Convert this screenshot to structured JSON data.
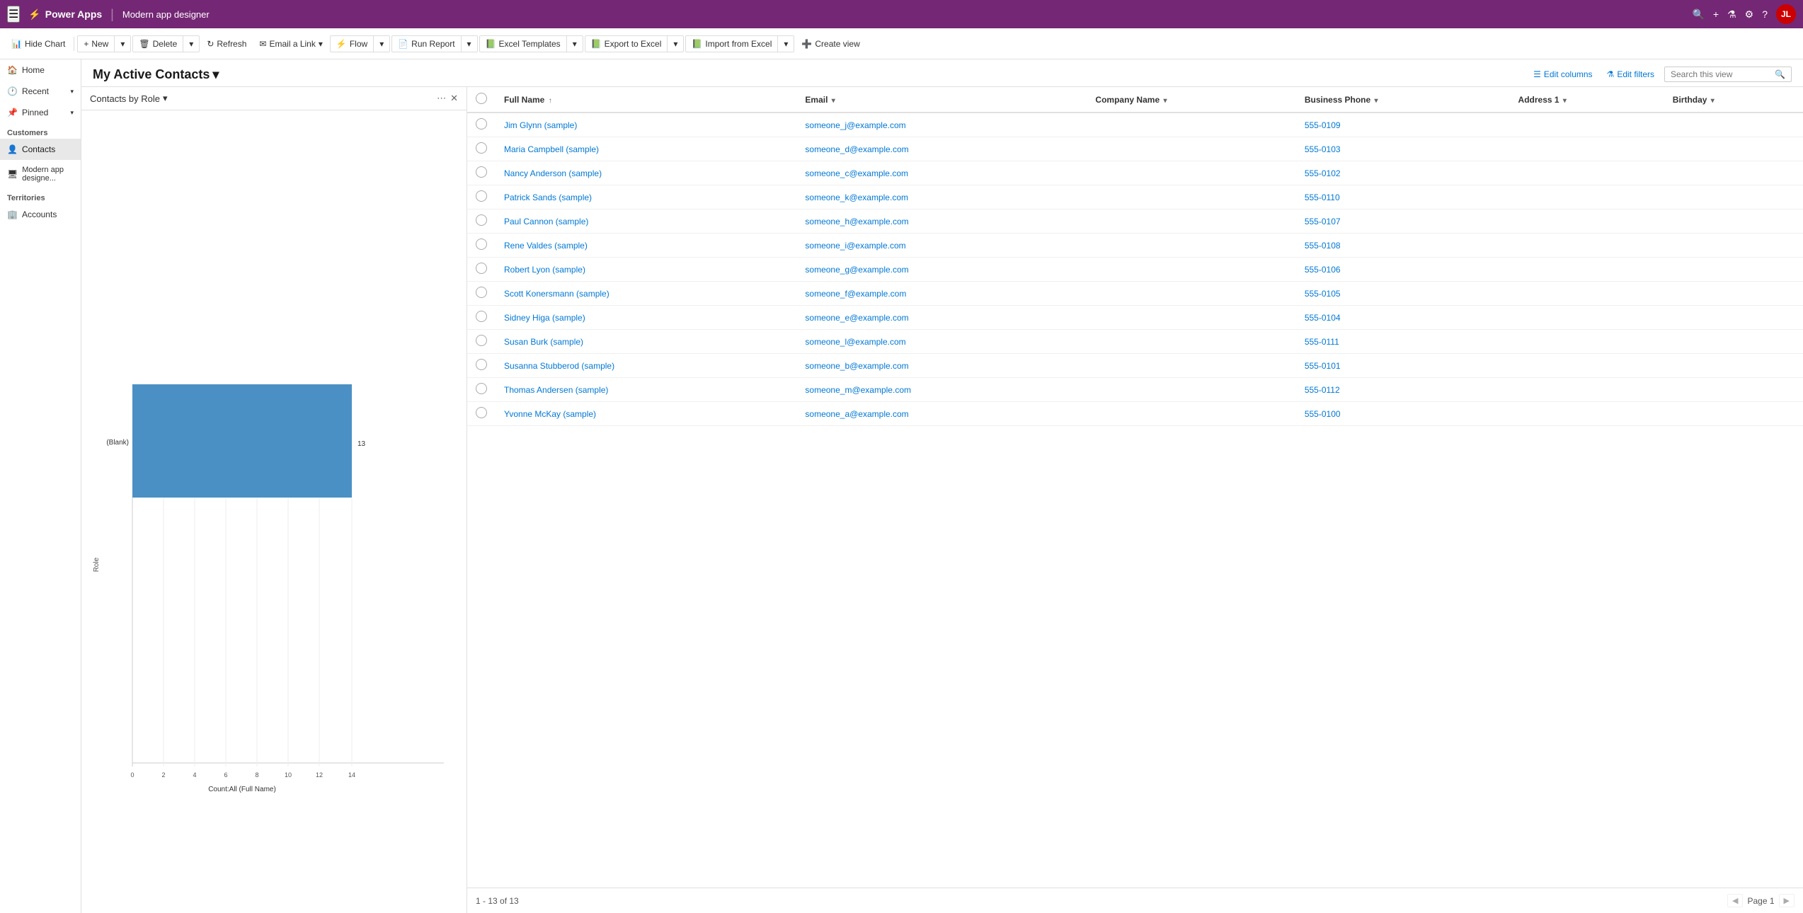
{
  "topNav": {
    "hamburger": "☰",
    "brand": "Power Apps",
    "appIcon": "⚡",
    "separator": "|",
    "pageTitle": "Modern app designer",
    "searchIcon": "🔍",
    "addIcon": "+",
    "filterIcon": "⚗",
    "settingsIcon": "⚙",
    "helpIcon": "?",
    "avatarInitials": "JL"
  },
  "toolbar": {
    "hideChart": "Hide Chart",
    "new": "New",
    "delete": "Delete",
    "refresh": "Refresh",
    "emailLink": "Email a Link",
    "flow": "Flow",
    "runReport": "Run Report",
    "excelTemplates": "Excel Templates",
    "exportToExcel": "Export to Excel",
    "importFromExcel": "Import from Excel",
    "createView": "Create view"
  },
  "viewHeader": {
    "title": "My Active Contacts",
    "chevron": "▾",
    "editColumns": "Edit columns",
    "editFilters": "Edit filters",
    "searchPlaceholder": "Search this view",
    "searchIcon": "🔍"
  },
  "chart": {
    "title": "Contacts by Role",
    "chevron": "▾",
    "moreIcon": "⋯",
    "closeIcon": "✕",
    "barColor": "#4a90c4",
    "blankLabel": "(Blank)",
    "roleLabel": "Role",
    "countLabel": "Count:All (Full Name)",
    "maxValue": 14,
    "data": [
      {
        "label": "(Blank)",
        "value": 13
      }
    ],
    "xAxisTicks": [
      0,
      2,
      4,
      6,
      8,
      10,
      12,
      14
    ]
  },
  "table": {
    "columns": [
      {
        "key": "fullName",
        "label": "Full Name",
        "sort": "↑"
      },
      {
        "key": "email",
        "label": "Email",
        "sort": "▾"
      },
      {
        "key": "companyName",
        "label": "Company Name",
        "sort": "▾"
      },
      {
        "key": "businessPhone",
        "label": "Business Phone",
        "sort": "▾"
      },
      {
        "key": "address1",
        "label": "Address 1",
        "sort": "▾"
      },
      {
        "key": "birthday",
        "label": "Birthday",
        "sort": "▾"
      }
    ],
    "rows": [
      {
        "fullName": "Jim Glynn (sample)",
        "email": "someone_j@example.com",
        "companyName": "",
        "businessPhone": "555-0109",
        "address1": "",
        "birthday": ""
      },
      {
        "fullName": "Maria Campbell (sample)",
        "email": "someone_d@example.com",
        "companyName": "",
        "businessPhone": "555-0103",
        "address1": "",
        "birthday": ""
      },
      {
        "fullName": "Nancy Anderson (sample)",
        "email": "someone_c@example.com",
        "companyName": "",
        "businessPhone": "555-0102",
        "address1": "",
        "birthday": ""
      },
      {
        "fullName": "Patrick Sands (sample)",
        "email": "someone_k@example.com",
        "companyName": "",
        "businessPhone": "555-0110",
        "address1": "",
        "birthday": ""
      },
      {
        "fullName": "Paul Cannon (sample)",
        "email": "someone_h@example.com",
        "companyName": "",
        "businessPhone": "555-0107",
        "address1": "",
        "birthday": ""
      },
      {
        "fullName": "Rene Valdes (sample)",
        "email": "someone_i@example.com",
        "companyName": "",
        "businessPhone": "555-0108",
        "address1": "",
        "birthday": ""
      },
      {
        "fullName": "Robert Lyon (sample)",
        "email": "someone_g@example.com",
        "companyName": "",
        "businessPhone": "555-0106",
        "address1": "",
        "birthday": ""
      },
      {
        "fullName": "Scott Konersmann (sample)",
        "email": "someone_f@example.com",
        "companyName": "",
        "businessPhone": "555-0105",
        "address1": "",
        "birthday": ""
      },
      {
        "fullName": "Sidney Higa (sample)",
        "email": "someone_e@example.com",
        "companyName": "",
        "businessPhone": "555-0104",
        "address1": "",
        "birthday": ""
      },
      {
        "fullName": "Susan Burk (sample)",
        "email": "someone_l@example.com",
        "companyName": "",
        "businessPhone": "555-0111",
        "address1": "",
        "birthday": ""
      },
      {
        "fullName": "Susanna Stubberod (sample)",
        "email": "someone_b@example.com",
        "companyName": "",
        "businessPhone": "555-0101",
        "address1": "",
        "birthday": ""
      },
      {
        "fullName": "Thomas Andersen (sample)",
        "email": "someone_m@example.com",
        "companyName": "",
        "businessPhone": "555-0112",
        "address1": "",
        "birthday": ""
      },
      {
        "fullName": "Yvonne McKay (sample)",
        "email": "someone_a@example.com",
        "companyName": "",
        "businessPhone": "555-0100",
        "address1": "",
        "birthday": ""
      }
    ],
    "footer": {
      "range": "1 - 13 of 13",
      "page": "Page 1"
    }
  },
  "sidebar": {
    "sections": [
      {
        "label": "Customers",
        "items": [
          {
            "icon": "👤",
            "label": "Contacts",
            "active": true
          },
          {
            "icon": "🖥",
            "label": "Modern app designe...",
            "active": false
          }
        ]
      },
      {
        "label": "Territories",
        "items": [
          {
            "icon": "🏢",
            "label": "Accounts",
            "active": false
          }
        ]
      }
    ],
    "topItems": [
      {
        "icon": "🏠",
        "label": "Home"
      },
      {
        "icon": "🕐",
        "label": "Recent",
        "hasChevron": true
      },
      {
        "icon": "📌",
        "label": "Pinned",
        "hasChevron": true
      }
    ]
  }
}
